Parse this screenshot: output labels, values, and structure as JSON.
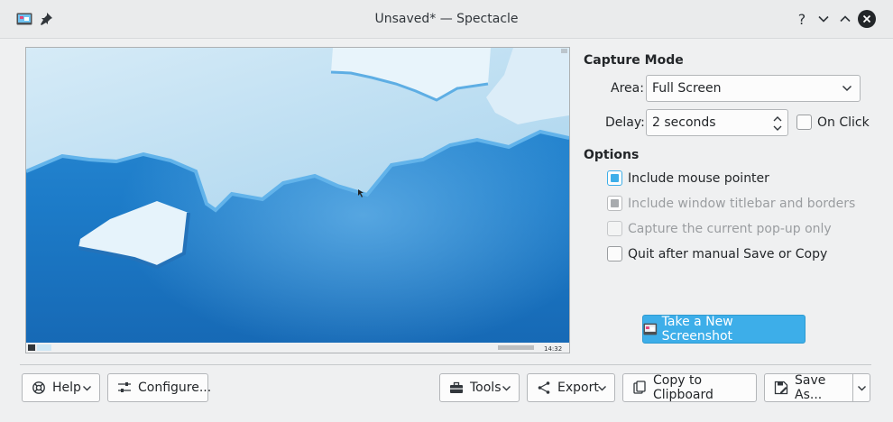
{
  "window": {
    "title": "Unsaved* — Spectacle"
  },
  "titlebar": {
    "help": "?"
  },
  "preview": {
    "taskbar_clock": "14:32"
  },
  "capture_mode": {
    "heading": "Capture Mode",
    "area_label": "Area:",
    "area_value": "Full Screen",
    "delay_label": "Delay:",
    "delay_value": "2 seconds",
    "on_click_label": "On Click",
    "on_click_checked": false
  },
  "options": {
    "heading": "Options",
    "items": [
      {
        "label": "Include mouse pointer",
        "checked": true,
        "enabled": true
      },
      {
        "label": "Include window titlebar and borders",
        "checked": true,
        "enabled": false
      },
      {
        "label": "Capture the current pop-up only",
        "checked": false,
        "enabled": false
      },
      {
        "label": "Quit after manual Save or Copy",
        "checked": false,
        "enabled": true
      }
    ]
  },
  "actions": {
    "take_screenshot": "Take a New Screenshot",
    "help": "Help",
    "configure": "Configure...",
    "tools": "Tools",
    "export": "Export",
    "copy": "Copy to Clipboard",
    "save_as": "Save As..."
  },
  "colors": {
    "accent": "#3daee9",
    "window_bg": "#eff0f1",
    "titlebar_bg": "#eaebec"
  }
}
